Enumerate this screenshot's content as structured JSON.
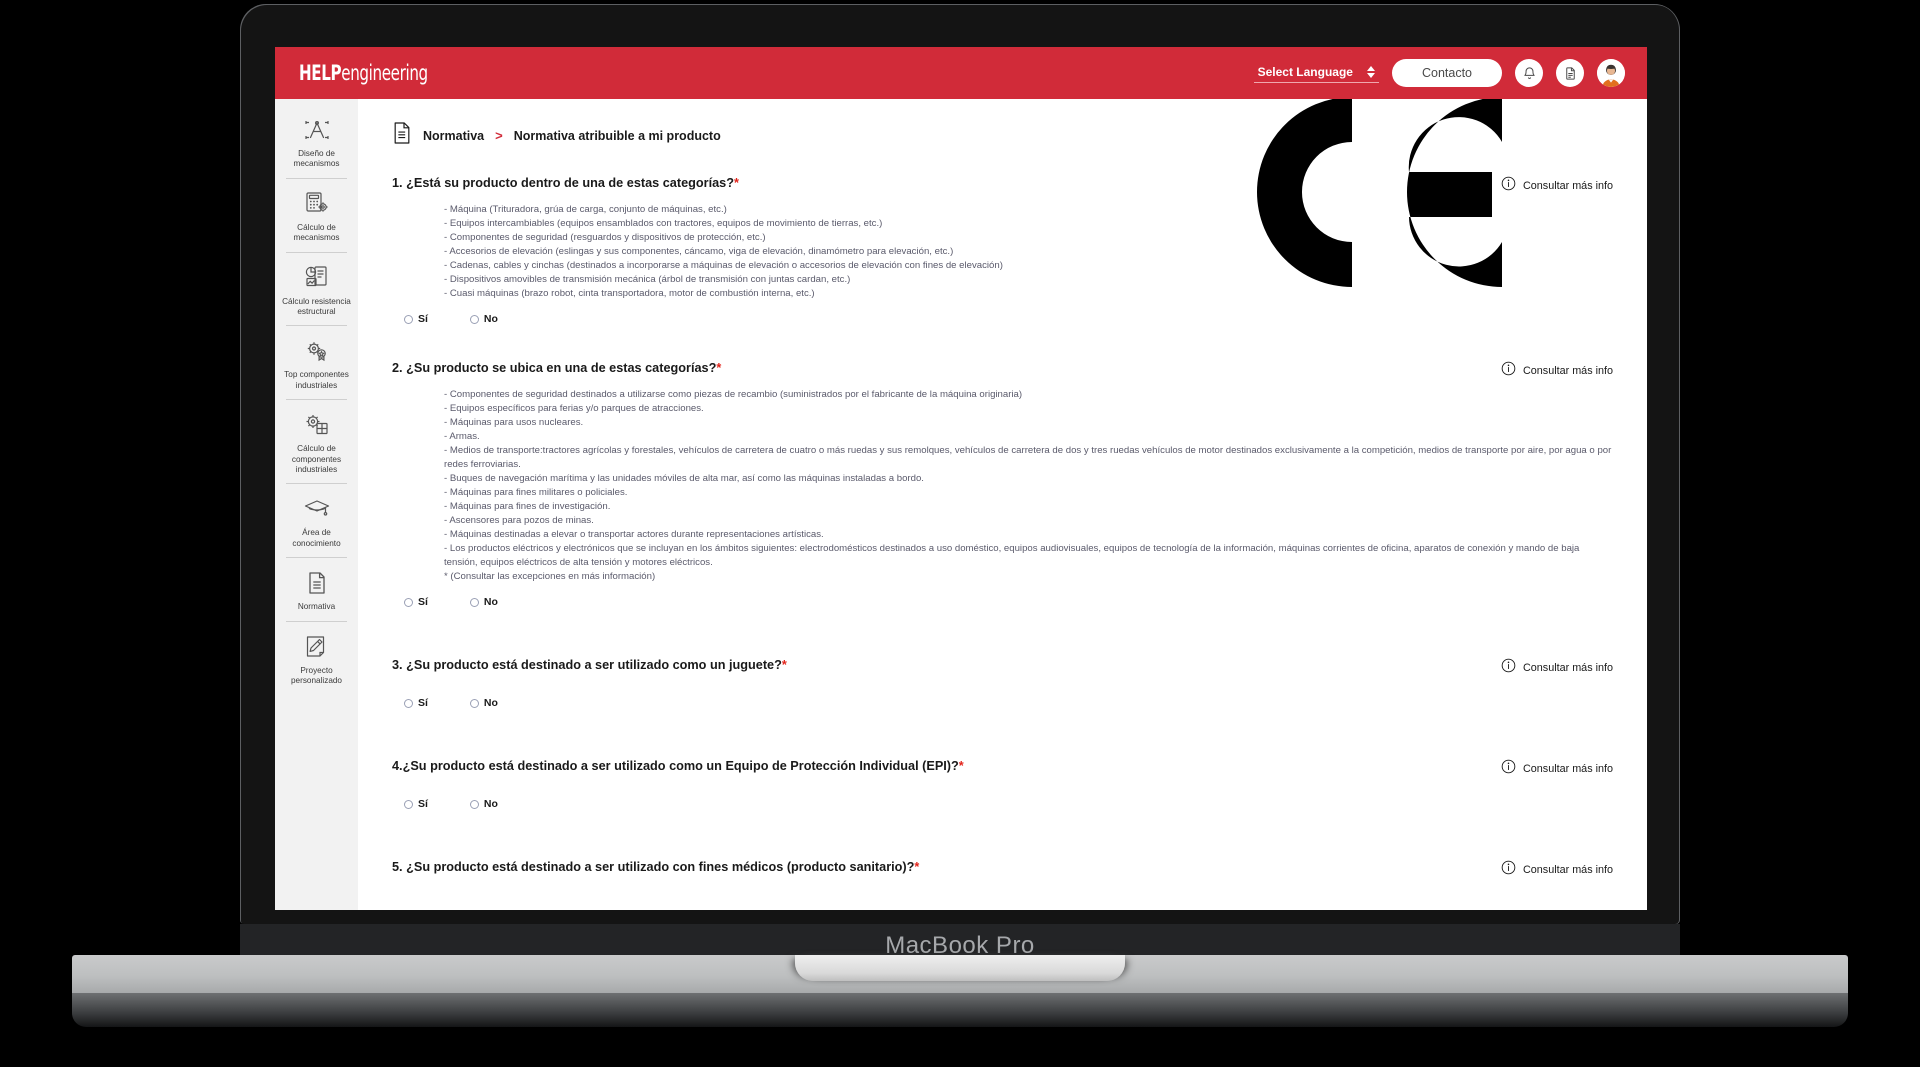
{
  "device": {
    "brand_label": "MacBook Pro"
  },
  "header": {
    "logo_bold": "HELP",
    "logo_light": "engineering",
    "language_label": "Select Language",
    "contact_label": "Contacto",
    "icons": {
      "notifications": "bell-icon",
      "documents": "documents-icon",
      "account": "user-avatar-icon"
    }
  },
  "sidebar": {
    "items": [
      {
        "label": "Diseño de mecanismos",
        "icon": "compass-drafting-icon"
      },
      {
        "label": "Cálculo de mecanismos",
        "icon": "calculator-gear-icon"
      },
      {
        "label": "Cálculo resistencia estructural",
        "icon": "chart-report-icon"
      },
      {
        "label": "Top componentes industriales",
        "icon": "gear-badge-icon"
      },
      {
        "label": "Cálculo de componentes industriales",
        "icon": "gear-grid-icon"
      },
      {
        "label": "Área de conocimiento",
        "icon": "graduation-cap-icon"
      },
      {
        "label": "Normativa",
        "icon": "document-lines-icon"
      },
      {
        "label": "Proyecto personalizado",
        "icon": "pencil-document-icon"
      }
    ]
  },
  "breadcrumb": {
    "icon": "document-lines-icon",
    "parent": "Normativa",
    "separator": ">",
    "current": "Normativa atribuible a mi producto"
  },
  "common": {
    "info_label": "Consultar más info",
    "info_icon": "info-circle-icon",
    "yes_label": "Sí",
    "no_label": "No",
    "required_mark": "*"
  },
  "questions": [
    {
      "number": "1.",
      "title": "¿Está su producto dentro de una de estas categorías?",
      "items": [
        "- Máquina (Trituradora, grúa de carga, conjunto de máquinas, etc.)",
        "- Equipos intercambiables (equipos ensamblados con tractores, equipos de movimiento de tierras, etc.)",
        "- Componentes de seguridad (resguardos y dispositivos de protección, etc.)",
        "- Accesorios de elevación (eslingas y sus componentes, cáncamo, viga de elevación, dinamómetro para elevación, etc.)",
        "- Cadenas, cables y cinchas (destinados a incorporarse a máquinas de elevación o accesorios de elevación con fines de elevación)",
        "- Dispositivos amovibles de transmisión mecánica (árbol de transmisión con juntas cardan, etc.)",
        "- Cuasi máquinas (brazo robot, cinta transportadora, motor de combustión interna, etc.)"
      ]
    },
    {
      "number": "2.",
      "title": "¿Su producto se ubica en una de estas categorías?",
      "items": [
        "- Componentes de seguridad destinados a utilizarse como piezas de recambio (suministrados por el fabricante de la máquina originaria)",
        "- Equipos específicos para ferias y/o parques de atracciones.",
        "- Máquinas para usos nucleares.",
        "- Armas.",
        "- Medios de transporte:tractores agrícolas y forestales, vehículos de carretera de cuatro o más ruedas y sus remolques, vehículos de carretera de dos y tres ruedas vehículos de motor destinados exclusivamente a la competición, medios de transporte por aire, por agua o por redes ferroviarias.",
        "- Buques de navegación marítima y las unidades móviles de alta mar, así como las máquinas instaladas a bordo.",
        "- Máquinas para fines militares o policiales.",
        "- Máquinas para fines de investigación.",
        "- Ascensores para pozos de minas.",
        "- Máquinas destinadas a elevar o transportar actores durante representaciones artísticas.",
        "- Los productos eléctricos y electrónicos que se incluyan en los ámbitos siguientes: electrodomésticos destinados a uso doméstico, equipos audiovisuales, equipos de tecnología de la información, máquinas corrientes de oficina, aparatos de conexión y mando de baja tensión, equipos eléctricos de alta tensión y motores eléctricos.",
        "* (Consultar las excepciones en más información)"
      ]
    },
    {
      "number": "3.",
      "title": "¿Su producto está destinado a ser utilizado como un juguete?",
      "items": []
    },
    {
      "number": "4.",
      "title": "¿Su producto está destinado a ser utilizado como un Equipo de Protección Individual (EPI)?",
      "items": []
    },
    {
      "number": "5.",
      "title": "¿Su producto está destinado a ser utilizado con fines médicos (producto sanitario)?",
      "items": []
    }
  ],
  "colors": {
    "brand_red": "#D12B39",
    "required_red": "#e2231a",
    "sidebar_bg": "#f2f2f2",
    "body_text": "#5a5a6b"
  }
}
